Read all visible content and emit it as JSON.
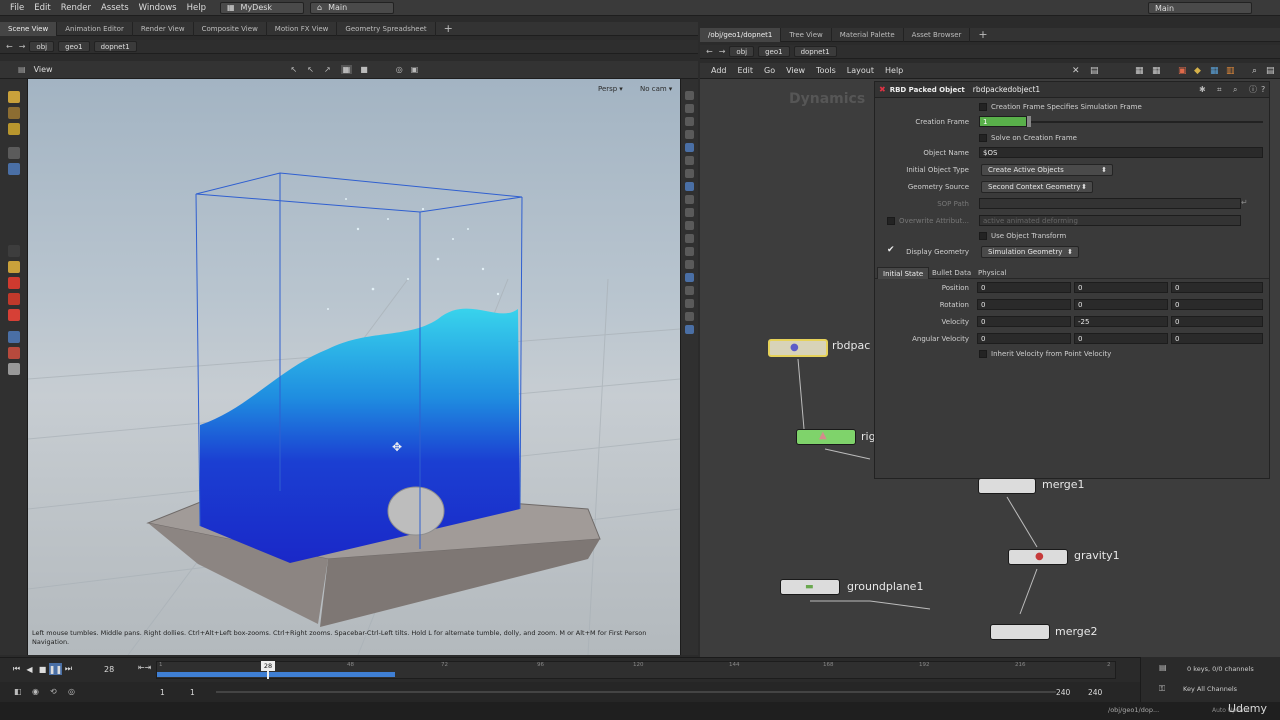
{
  "menubar": {
    "items": [
      "File",
      "Edit",
      "Render",
      "Assets",
      "Windows",
      "Help"
    ],
    "desktop": "MyDesk",
    "main": "Main",
    "right_main": "Main"
  },
  "left_pane": {
    "tabs": [
      "Scene View",
      "Animation Editor",
      "Render View",
      "Composite View",
      "Motion FX View",
      "Geometry Spreadsheet"
    ],
    "path": [
      "obj",
      "geo1",
      "dopnet1"
    ],
    "view_label": "View",
    "persp": "Persp",
    "cam": "No cam",
    "hint": "Left mouse tumbles. Middle pans. Right dollies. Ctrl+Alt+Left box-zooms. Ctrl+Right zooms. Spacebar-Ctrl-Left tilts. Hold L for alternate tumble, dolly, and zoom.    M or Alt+M for First Person Navigation."
  },
  "right_pane": {
    "tabs": [
      "/obj/geo1/dopnet1",
      "Tree View",
      "Material Palette",
      "Asset Browser"
    ],
    "path": [
      "obj",
      "geo1",
      "dopnet1"
    ],
    "menu": [
      "Add",
      "Edit",
      "Go",
      "View",
      "Tools",
      "Layout",
      "Help"
    ],
    "context_label": "Dynamics"
  },
  "params": {
    "node_type": "RBD Packed Object",
    "node_name": "rbdpackedobject1",
    "creation_frame_specifies": "Creation Frame Specifies Simulation Frame",
    "creation_frame_label": "Creation Frame",
    "creation_frame_value": "1",
    "solve_on_creation": "Solve on Creation Frame",
    "object_name_label": "Object Name",
    "object_name_value": "$OS",
    "initial_type_label": "Initial Object Type",
    "initial_type_value": "Create Active Objects",
    "geo_source_label": "Geometry Source",
    "geo_source_value": "Second Context Geometry",
    "sop_path_label": "SOP Path",
    "overwrite_label": "Overwrite Attribut...",
    "overwrite_value": "active animated deforming",
    "use_object_transform": "Use Object Transform",
    "display_geo_label": "Display Geometry",
    "display_geo_value": "Simulation Geometry",
    "tabs": [
      "Initial State",
      "Bullet Data",
      "Physical"
    ],
    "position_label": "Position",
    "position": [
      "0",
      "0",
      "0"
    ],
    "rotation_label": "Rotation",
    "rotation": [
      "0",
      "0",
      "0"
    ],
    "velocity_label": "Velocity",
    "velocity": [
      "0",
      "-25",
      "0"
    ],
    "angular_label": "Angular Velocity",
    "angular": [
      "0",
      "0",
      "0"
    ],
    "inherit_velocity": "Inherit Velocity from Point Velocity"
  },
  "nodes": {
    "rbdpac": "rbdpac",
    "rig": "rig",
    "merge1": "merge1",
    "gravity1": "gravity1",
    "groundplane1": "groundplane1",
    "merge2": "merge2"
  },
  "timeline": {
    "current_frame": "28",
    "marker_frame": "28",
    "ticks": [
      "1",
      "48",
      "72",
      "96",
      "120",
      "144",
      "168",
      "192",
      "216",
      "2"
    ],
    "start": "1",
    "start2": "1",
    "end": "240",
    "end2": "240",
    "keys_info": "0 keys, 0/0 channels",
    "key_all": "Key All Channels"
  },
  "status": {
    "path": "/obj/geo1/dop...",
    "auto_update": "Auto Update",
    "watermark": "Udemy"
  },
  "colors": {
    "accent_blue": "#3f7fd4",
    "water_dark": "#1a2fd0",
    "water_light": "#35c8e8",
    "node_green": "#7fd36b",
    "node_yellow": "#e6d25a",
    "creation_frame_green": "#59b04a"
  }
}
